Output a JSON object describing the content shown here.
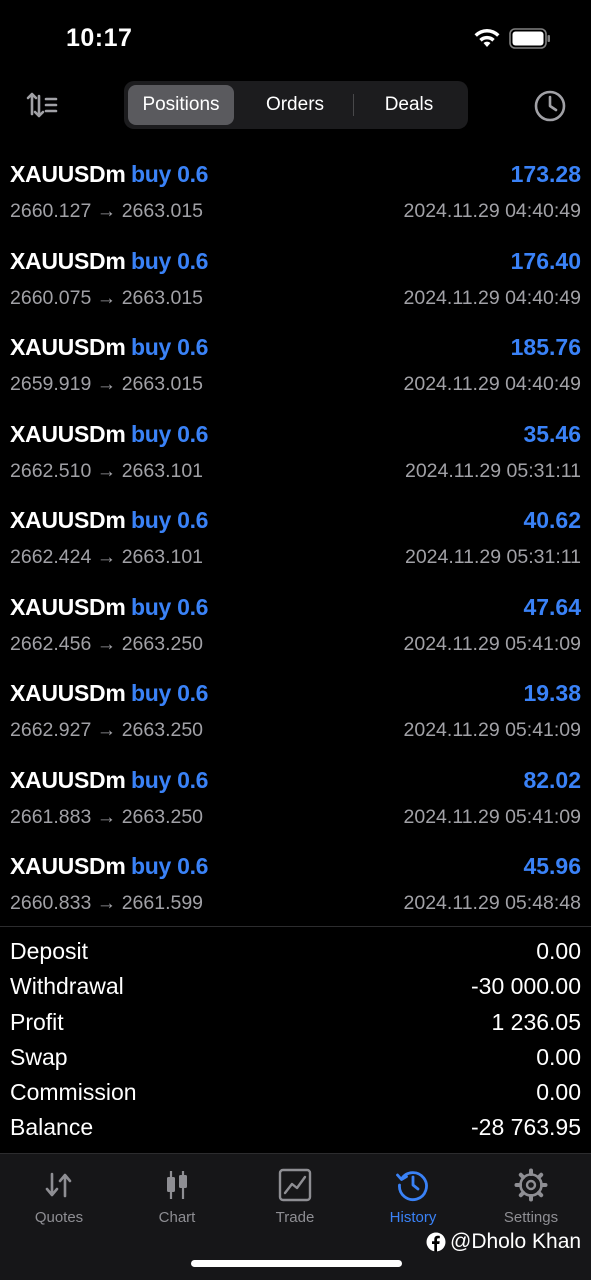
{
  "status_bar": {
    "time": "10:17"
  },
  "segments": [
    {
      "label": "Positions",
      "active": true
    },
    {
      "label": "Orders",
      "active": false
    },
    {
      "label": "Deals",
      "active": false
    }
  ],
  "deals": [
    {
      "symbol": "XAUUSDm",
      "side": "buy 0.6",
      "profit": "173.28",
      "open_price": "2660.127",
      "close_price": "2663.015",
      "time": "2024.11.29 04:40:49"
    },
    {
      "symbol": "XAUUSDm",
      "side": "buy 0.6",
      "profit": "176.40",
      "open_price": "2660.075",
      "close_price": "2663.015",
      "time": "2024.11.29 04:40:49"
    },
    {
      "symbol": "XAUUSDm",
      "side": "buy 0.6",
      "profit": "185.76",
      "open_price": "2659.919",
      "close_price": "2663.015",
      "time": "2024.11.29 04:40:49"
    },
    {
      "symbol": "XAUUSDm",
      "side": "buy 0.6",
      "profit": "35.46",
      "open_price": "2662.510",
      "close_price": "2663.101",
      "time": "2024.11.29 05:31:11"
    },
    {
      "symbol": "XAUUSDm",
      "side": "buy 0.6",
      "profit": "40.62",
      "open_price": "2662.424",
      "close_price": "2663.101",
      "time": "2024.11.29 05:31:11"
    },
    {
      "symbol": "XAUUSDm",
      "side": "buy 0.6",
      "profit": "47.64",
      "open_price": "2662.456",
      "close_price": "2663.250",
      "time": "2024.11.29 05:41:09"
    },
    {
      "symbol": "XAUUSDm",
      "side": "buy 0.6",
      "profit": "19.38",
      "open_price": "2662.927",
      "close_price": "2663.250",
      "time": "2024.11.29 05:41:09"
    },
    {
      "symbol": "XAUUSDm",
      "side": "buy 0.6",
      "profit": "82.02",
      "open_price": "2661.883",
      "close_price": "2663.250",
      "time": "2024.11.29 05:41:09"
    },
    {
      "symbol": "XAUUSDm",
      "side": "buy 0.6",
      "profit": "45.96",
      "open_price": "2660.833",
      "close_price": "2661.599",
      "time": "2024.11.29 05:48:48"
    }
  ],
  "summary": [
    {
      "label": "Deposit",
      "value": "0.00"
    },
    {
      "label": "Withdrawal",
      "value": "-30 000.00"
    },
    {
      "label": "Profit",
      "value": "1 236.05"
    },
    {
      "label": "Swap",
      "value": "0.00"
    },
    {
      "label": "Commission",
      "value": "0.00"
    },
    {
      "label": "Balance",
      "value": "-28 763.95"
    }
  ],
  "tabs": [
    {
      "label": "Quotes",
      "icon": "quotes-icon",
      "active": false
    },
    {
      "label": "Chart",
      "icon": "chart-icon",
      "active": false
    },
    {
      "label": "Trade",
      "icon": "trade-icon",
      "active": false
    },
    {
      "label": "History",
      "icon": "history-icon",
      "active": true
    },
    {
      "label": "Settings",
      "icon": "settings-icon",
      "active": false
    }
  ],
  "watermark": {
    "text": "@Dholo Khan",
    "icon": "facebook-icon"
  },
  "colors": {
    "accent": "#3a82f7",
    "secondary_text": "#a1a1a6",
    "background": "#000000"
  }
}
